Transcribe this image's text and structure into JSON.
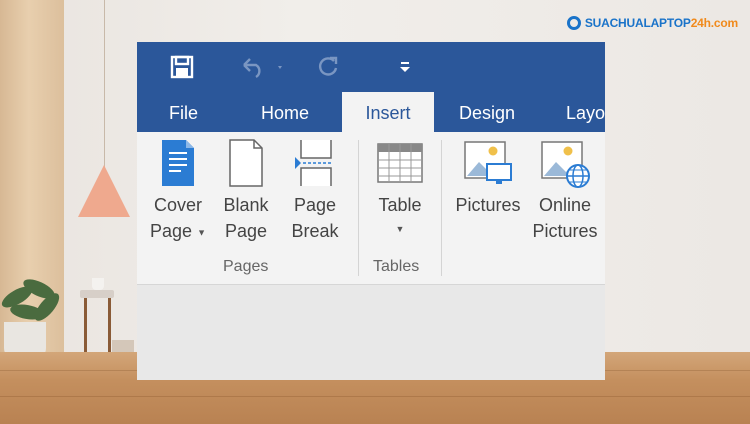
{
  "watermark": {
    "brand_main": "SUACHUALAPTOP",
    "brand_accent": "24h.com"
  },
  "qat": {
    "save_icon": "save-icon",
    "undo_icon": "undo-icon",
    "redo_icon": "redo-icon",
    "customize_icon": "customize-arrow-icon"
  },
  "tabs": [
    {
      "label": "File"
    },
    {
      "label": "Home"
    },
    {
      "label": "Insert",
      "active": true
    },
    {
      "label": "Design"
    },
    {
      "label": "Layo"
    }
  ],
  "ribbon": {
    "pages": {
      "group_label": "Pages",
      "cover_line1": "Cover",
      "cover_line2": "Page",
      "blank_line1": "Blank",
      "blank_line2": "Page",
      "break_line1": "Page",
      "break_line2": "Break"
    },
    "tables": {
      "group_label": "Tables",
      "table_label": "Table"
    },
    "illustrations": {
      "pictures_label": "Pictures",
      "online_line1": "Online",
      "online_line2": "Pictures"
    }
  },
  "colors": {
    "word_blue": "#2b579a",
    "ribbon_bg": "#f3f3f3",
    "icon_blue": "#2b7cd3"
  }
}
